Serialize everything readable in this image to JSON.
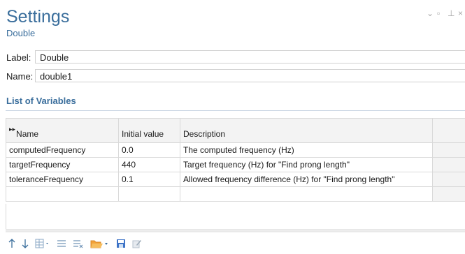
{
  "header": {
    "title": "Settings",
    "subtitle": "Double"
  },
  "window_controls": {
    "dropdown": "⌄",
    "restore": "▫",
    "pin": "⊥",
    "close": "×"
  },
  "fields": {
    "label": {
      "caption": "Label:",
      "value": "Double"
    },
    "name": {
      "caption": "Name:",
      "value": "double1"
    }
  },
  "section": {
    "title": "List of Variables"
  },
  "table": {
    "columns": [
      "Name",
      "Initial value",
      "Description"
    ],
    "rows": [
      {
        "name": "computedFrequency",
        "initial": "0.0",
        "description": "The computed frequency (Hz)"
      },
      {
        "name": "targetFrequency",
        "initial": "440",
        "description": "Target frequency (Hz) for \"Find prong length\""
      },
      {
        "name": "toleranceFrequency",
        "initial": "0.1",
        "description": "Allowed frequency difference (Hz) for \"Find prong length\""
      }
    ]
  },
  "toolbar": {
    "icons": [
      "move-up-icon",
      "move-down-icon",
      "add-table-icon",
      "clear-table-icon",
      "delete-rows-icon",
      "load-from-file-icon",
      "save-to-file-icon",
      "edit-icon"
    ]
  }
}
